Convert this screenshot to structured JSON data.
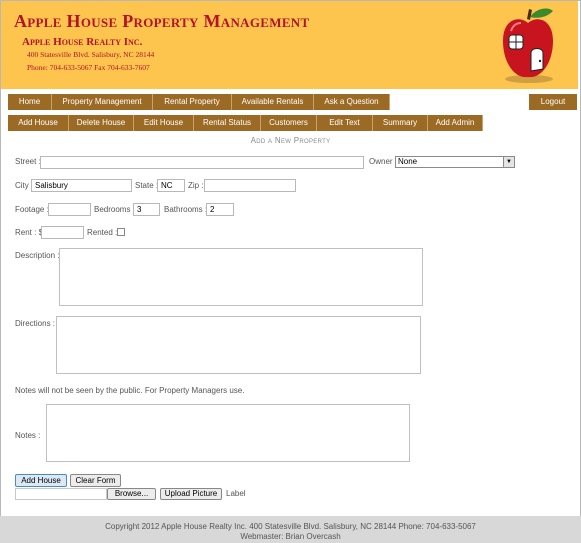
{
  "header": {
    "title": "Apple House Property Management",
    "company": "Apple House Realty Inc.",
    "address": "400 Statesville Blvd. Salisbury, NC 28144",
    "phone": "Phone: 704-633-5067 Fax 704-633-7607",
    "logo_icon": "apple-house-icon"
  },
  "nav_main": [
    {
      "label": "Home"
    },
    {
      "label": "Property Management"
    },
    {
      "label": "Rental Property"
    },
    {
      "label": "Available Rentals"
    },
    {
      "label": "Ask a Question"
    }
  ],
  "logout_label": "Logout",
  "nav_admin": [
    {
      "label": "Add House"
    },
    {
      "label": "Delete House"
    },
    {
      "label": "Edit House"
    },
    {
      "label": "Rental Status"
    },
    {
      "label": "Customers"
    },
    {
      "label": "Edit Text"
    },
    {
      "label": "Summary"
    },
    {
      "label": "Add Admin"
    }
  ],
  "form": {
    "title": "Add a New Property",
    "street_label": "Street :",
    "street_value": "",
    "owner_label": "Owner :",
    "owner_value": "None",
    "city_label": "City :",
    "city_value": "Salisbury",
    "state_label": "State :",
    "state_value": "NC",
    "zip_label": "Zip :",
    "zip_value": "",
    "footage_label": "Footage :",
    "footage_value": "",
    "bedrooms_label": "Bedrooms :",
    "bedrooms_value": "3",
    "bathrooms_label": "Bathrooms :",
    "bathrooms_value": "2",
    "rent_label": "Rent : $",
    "rent_value": "",
    "rented_label": "Rented :",
    "description_label": "Description :",
    "directions_label": "Directions :",
    "notes_info": "Notes will not be seen by the public. For Property Managers use.",
    "notes_label": "Notes :",
    "add_button": "Add House",
    "clear_button": "Clear Form",
    "browse_button": "Browse...",
    "upload_button": "Upload Picture",
    "upload_label": "Label"
  },
  "footer": {
    "copyright": "Copyright 2012 Apple House Realty Inc. 400 Statesville Blvd. Salisbury, NC 28144 Phone: 704-633-5067",
    "webmaster": "Webmaster: Brian Overcash"
  },
  "colors": {
    "header_bg": "#fdc54e",
    "title_red": "#b5122a",
    "nav_brown": "#9b6a24"
  }
}
